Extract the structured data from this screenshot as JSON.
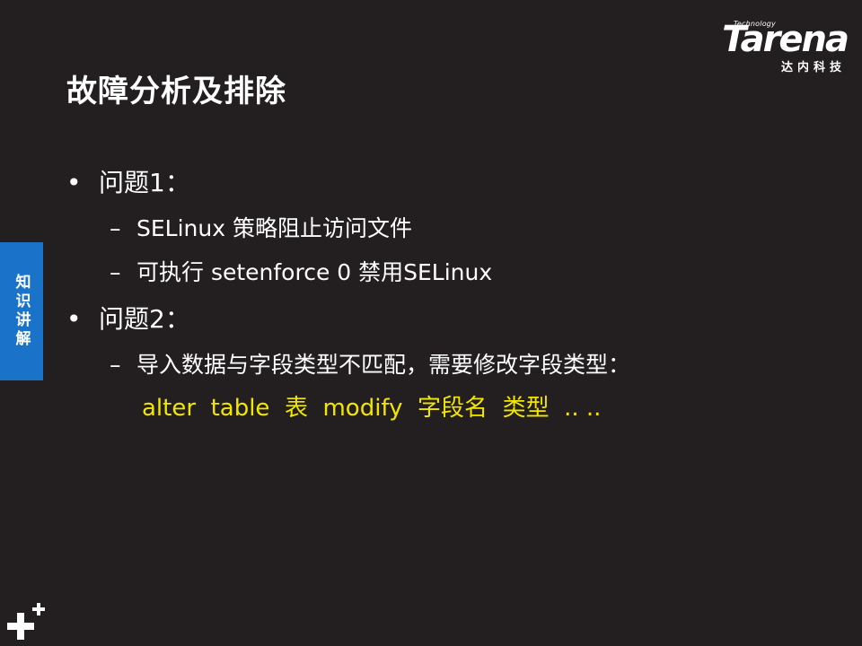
{
  "slide": {
    "title": "故障分析及排除",
    "side_tab": "知识讲解",
    "logo": {
      "small_text": "Technology",
      "wordmark": "Tarena",
      "chinese": "达内科技"
    },
    "bullets": [
      {
        "marker": "•",
        "text": "问题1：",
        "subitems": [
          {
            "marker": "–",
            "text": "SELinux 策略阻止访问文件"
          },
          {
            "marker": "–",
            "text": "可执行 setenforce  0 禁用SELinux"
          }
        ]
      },
      {
        "marker": "•",
        "text": "问题2：",
        "subitems": [
          {
            "marker": "–",
            "text": "导入数据与字段类型不匹配，需要修改字段类型："
          }
        ]
      }
    ],
    "code_line": "alter  table  表  modify  字段名  类型  .. ..",
    "colors": {
      "background": "#231f20",
      "text": "#ffffff",
      "code": "#f2e600",
      "side_tab": "#1a73c8"
    }
  }
}
